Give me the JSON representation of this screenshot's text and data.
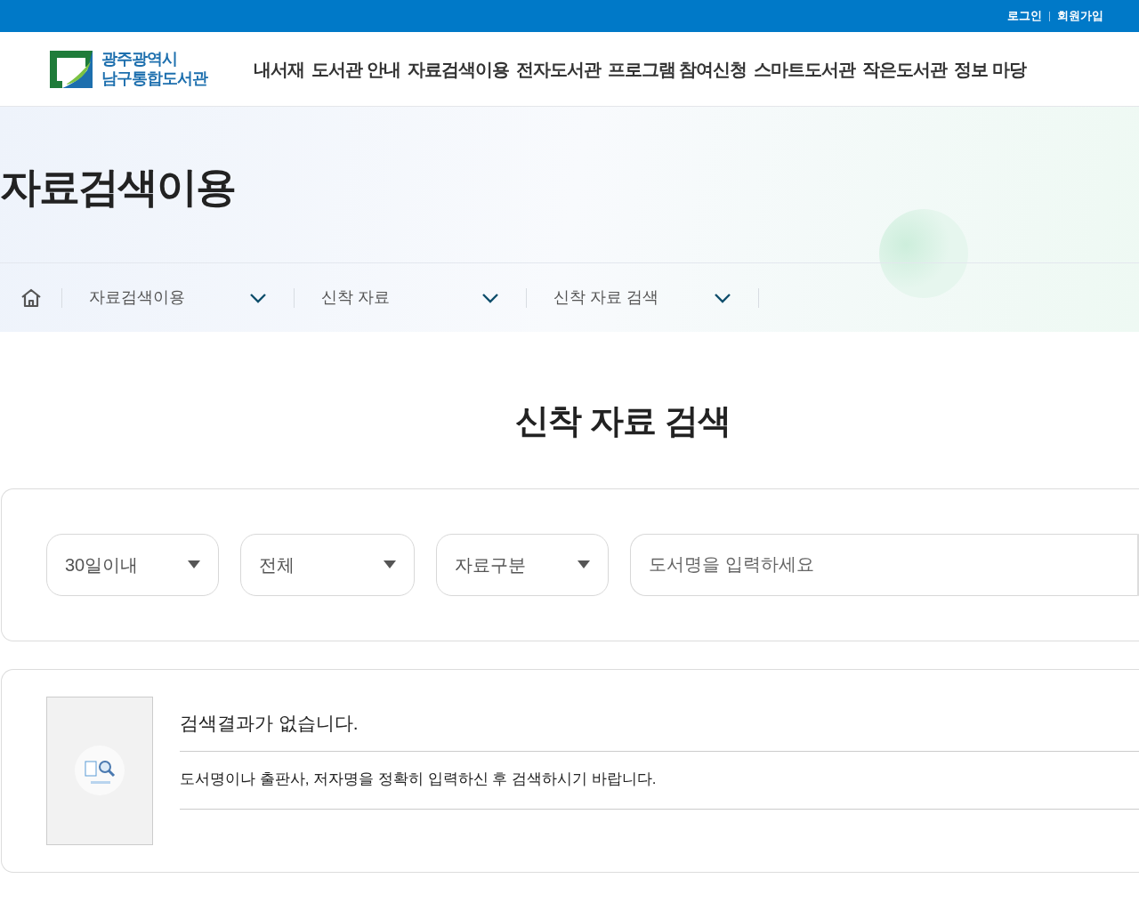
{
  "utility_links": [
    "로그인",
    "회원가입"
  ],
  "logo": {
    "line_1": "광주광역시",
    "line_2": "남구통합도서관"
  },
  "main_menu": [
    "내서재",
    "도서관 안내",
    "자료검색이용",
    "전자도서관",
    "프로그램 참여신청",
    "스마트도서관",
    "작은도서관",
    "정보 마당"
  ],
  "hero": {
    "title": "자료검색이용"
  },
  "breadcrumb": [
    "자료검색이용",
    "신착 자료",
    "신착 자료 검색"
  ],
  "page_title": "신착 자료 검색",
  "search": {
    "selects": [
      "30일이내",
      "전체",
      "자료구분"
    ],
    "placeholder": "도서명을 입력하세요"
  },
  "result": {
    "message": "검색결과가 없습니다.",
    "hint": "도서명이나 출판사, 저자명을 정확히 입력하신 후 검색하시기 바랍니다."
  }
}
